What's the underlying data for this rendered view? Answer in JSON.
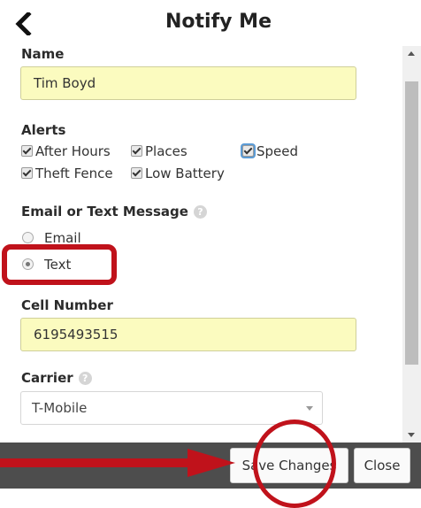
{
  "header": {
    "title": "Notify Me",
    "back_icon": "chevron-left-icon"
  },
  "form": {
    "name_label": "Name",
    "name_value": "Tim Boyd",
    "alerts_label": "Alerts",
    "alerts": [
      {
        "label": "After Hours",
        "checked": true
      },
      {
        "label": "Places",
        "checked": true
      },
      {
        "label": "Speed",
        "checked": true,
        "focused": true
      },
      {
        "label": "Theft Fence",
        "checked": true
      },
      {
        "label": "Low Battery",
        "checked": true
      }
    ],
    "contact_label": "Email or Text Message",
    "contact_options": [
      {
        "label": "Email",
        "selected": false
      },
      {
        "label": "Text",
        "selected": true
      }
    ],
    "cell_label": "Cell Number",
    "cell_value": "6195493515",
    "carrier_label": "Carrier",
    "carrier_value": "T-Mobile",
    "help_icon": "question-icon"
  },
  "footer": {
    "save_label": "Save Changes",
    "close_label": "Close"
  },
  "colors": {
    "annotation": "#c0121b",
    "field_bg": "#fbfbbf",
    "footer_bg": "#4d4d4d"
  }
}
